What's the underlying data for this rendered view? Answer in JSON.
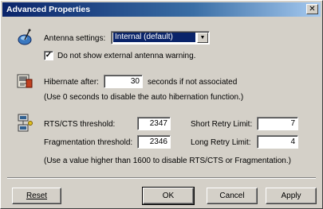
{
  "window": {
    "title": "Advanced Properties"
  },
  "antenna": {
    "label": "Antenna settings:",
    "selected": "Internal (default)",
    "checkbox_label": "Do not show external antenna warning.",
    "checkbox_checked": true
  },
  "hibernate": {
    "label": "Hibernate after:",
    "value": "30",
    "suffix": "seconds if not associated",
    "hint": "(Use 0 seconds to disable the auto hibernation function.)"
  },
  "thresholds": {
    "rts_label": "RTS/CTS threshold:",
    "rts_value": "2347",
    "frag_label": "Fragmentation threshold:",
    "frag_value": "2346",
    "short_retry_label": "Short Retry Limit:",
    "short_retry_value": "7",
    "long_retry_label": "Long Retry Limit:",
    "long_retry_value": "4",
    "hint": "(Use a value higher than 1600 to disable RTS/CTS or Fragmentation.)"
  },
  "buttons": {
    "reset": "Reset",
    "ok": "OK",
    "cancel": "Cancel",
    "apply": "Apply"
  },
  "icons": {
    "antenna": "antenna-icon",
    "hibernate": "hibernate-icon",
    "threshold": "network-icon",
    "close": "close-icon",
    "dropdown": "chevron-down-icon",
    "check": "check-icon"
  }
}
